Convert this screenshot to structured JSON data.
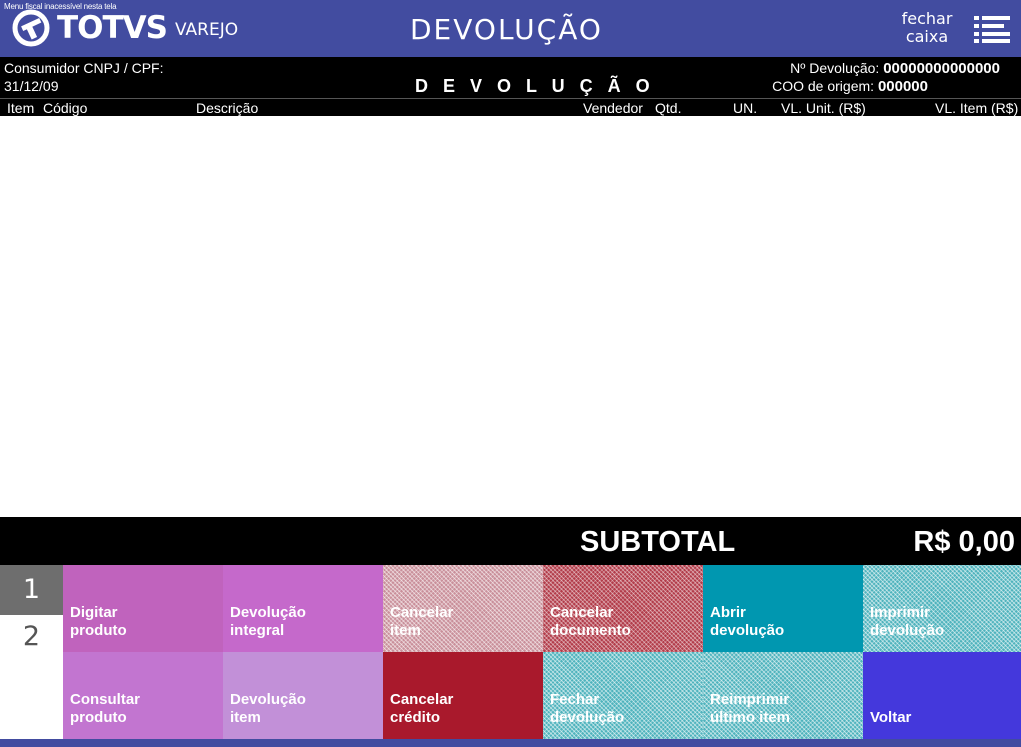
{
  "header": {
    "notice": "Menu fiscal inacessível nesta tela",
    "logo_text": "TOTVS",
    "logo_sub": "VAREJO",
    "title": "DEVOLUÇÃO",
    "close_line1": "fechar",
    "close_line2": "caixa",
    "menu_icon": "menu-list-icon"
  },
  "info": {
    "consumer_label": "Consumidor CNPJ / CPF:",
    "date": "31/12/09",
    "center_title": "D E V O L U Ç Ã O",
    "devolution_label": "Nº Devolução:",
    "devolution_value": "00000000000000",
    "coo_label": "COO de origem:",
    "coo_value": "000000"
  },
  "columns": {
    "item": "Item",
    "code": "Código",
    "description": "Descrição",
    "seller": "Vendedor",
    "qty": "Qtd.",
    "unit": "UN.",
    "unit_value": "VL. Unit. (R$)",
    "item_value": "VL. Item (R$)"
  },
  "subtotal": {
    "label": "SUBTOTAL",
    "value": "R$ 0,00"
  },
  "pages": {
    "page1": "1",
    "page2": "2",
    "active": "1"
  },
  "buttons": {
    "digitar_produto": "Digitar\nproduto",
    "devolucao_integral": "Devolução\nintegral",
    "cancelar_item": "Cancelar\nitem",
    "cancelar_documento": "Cancelar\ndocumento",
    "abrir_devolucao": "Abrir\ndevolução",
    "imprimir_devolucao": "Imprimir\ndevolução",
    "consultar_produto": "Consultar\nproduto",
    "devolucao_item": "Devolução\nitem",
    "cancelar_credito": "Cancelar\ncrédito",
    "fechar_devolucao": "Fechar\ndevolução",
    "reimprimir_ultimo_item": "Reimprimir\núltimo item",
    "voltar": "Voltar"
  },
  "colors": {
    "header_bg": "#424ca0",
    "magenta": "#c063bd",
    "magenta_light": "#c285d6",
    "lilac": "#c290d8",
    "teal": "#0097b0",
    "crimson": "#a9192c",
    "blue": "#4438dc"
  }
}
